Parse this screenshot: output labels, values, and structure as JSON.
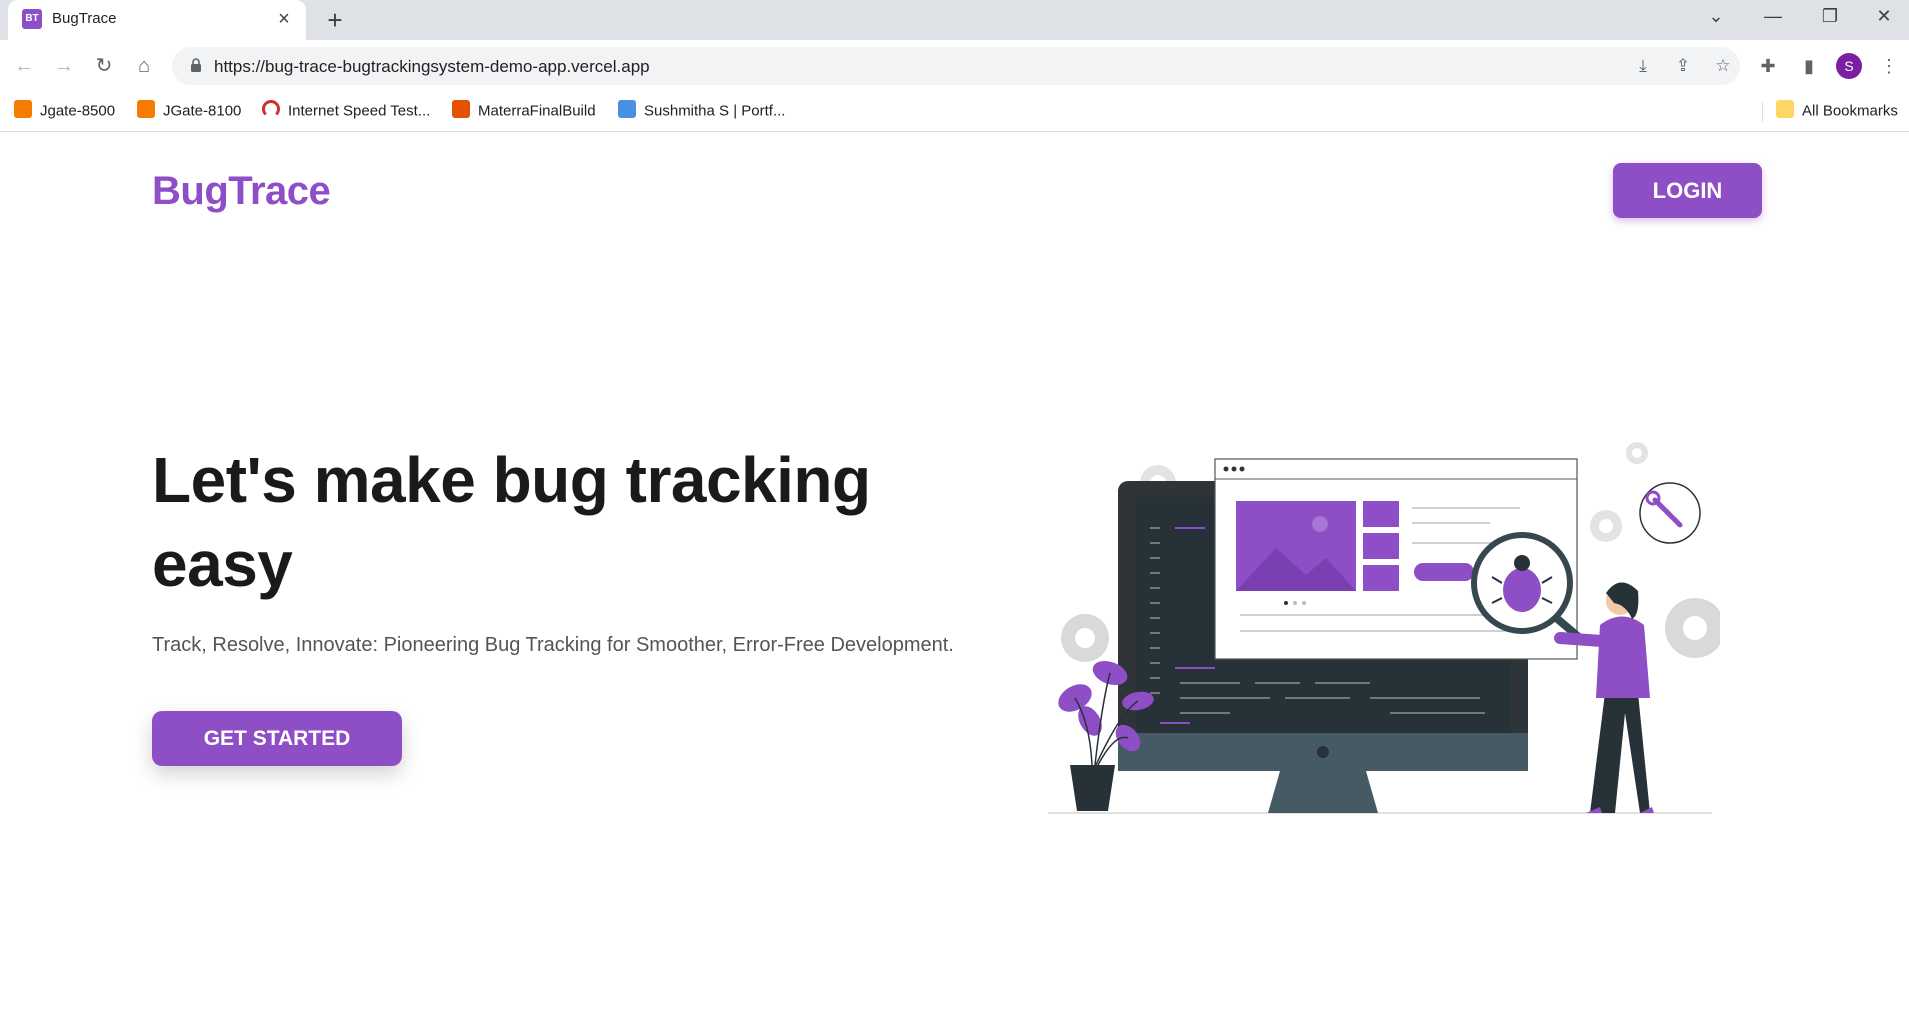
{
  "browser": {
    "tab": {
      "favicon_text": "BT",
      "title": "BugTrace"
    },
    "url": "https://bug-trace-bugtrackingsystem-demo-app.vercel.app",
    "profile_initial": "S",
    "bookmarks": [
      {
        "label": "Jgate-8500",
        "icon_color": "#f57c00"
      },
      {
        "label": "JGate-8100",
        "icon_color": "#f57c00"
      },
      {
        "label": "Internet Speed Test...",
        "icon_color": "#d32f2f"
      },
      {
        "label": "MaterraFinalBuild",
        "icon_color": "#e65100"
      },
      {
        "label": "Sushmitha S | Portf...",
        "icon_color": "#4a90e2"
      }
    ],
    "all_bookmarks_label": "All Bookmarks"
  },
  "page": {
    "brand": "BugTrace",
    "login_label": "LOGIN",
    "hero_title": "Let's make bug tracking easy",
    "hero_subtitle": "Track, Resolve, Innovate: Pioneering Bug Tracking for Smoother, Error-Free Development.",
    "cta_label": "GET STARTED",
    "accent_color": "#8e4ec6"
  }
}
